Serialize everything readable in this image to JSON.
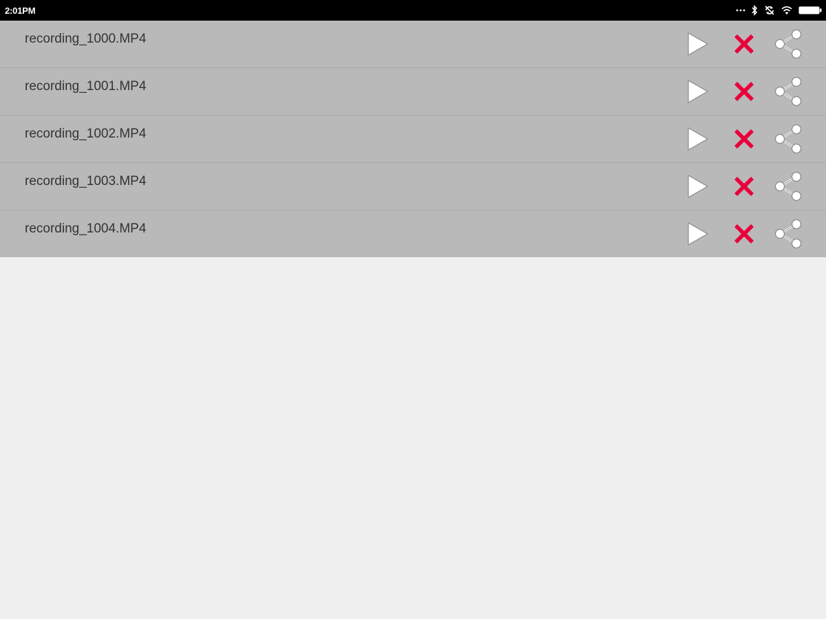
{
  "status_bar": {
    "time": "2:01PM",
    "icons": [
      "more-dots-icon",
      "bluetooth-icon",
      "sync-icon",
      "wifi-icon",
      "battery-icon"
    ]
  },
  "recordings": [
    {
      "name": "recording_1000.MP4"
    },
    {
      "name": "recording_1001.MP4"
    },
    {
      "name": "recording_1002.MP4"
    },
    {
      "name": "recording_1003.MP4"
    },
    {
      "name": "recording_1004.MP4"
    }
  ],
  "row_actions": [
    "play-icon",
    "delete-icon",
    "share-icon"
  ],
  "colors": {
    "row_background": "#b9b9b9",
    "page_background": "#efefef",
    "delete_accent": "#e8003d",
    "status_bar": "#000000"
  }
}
